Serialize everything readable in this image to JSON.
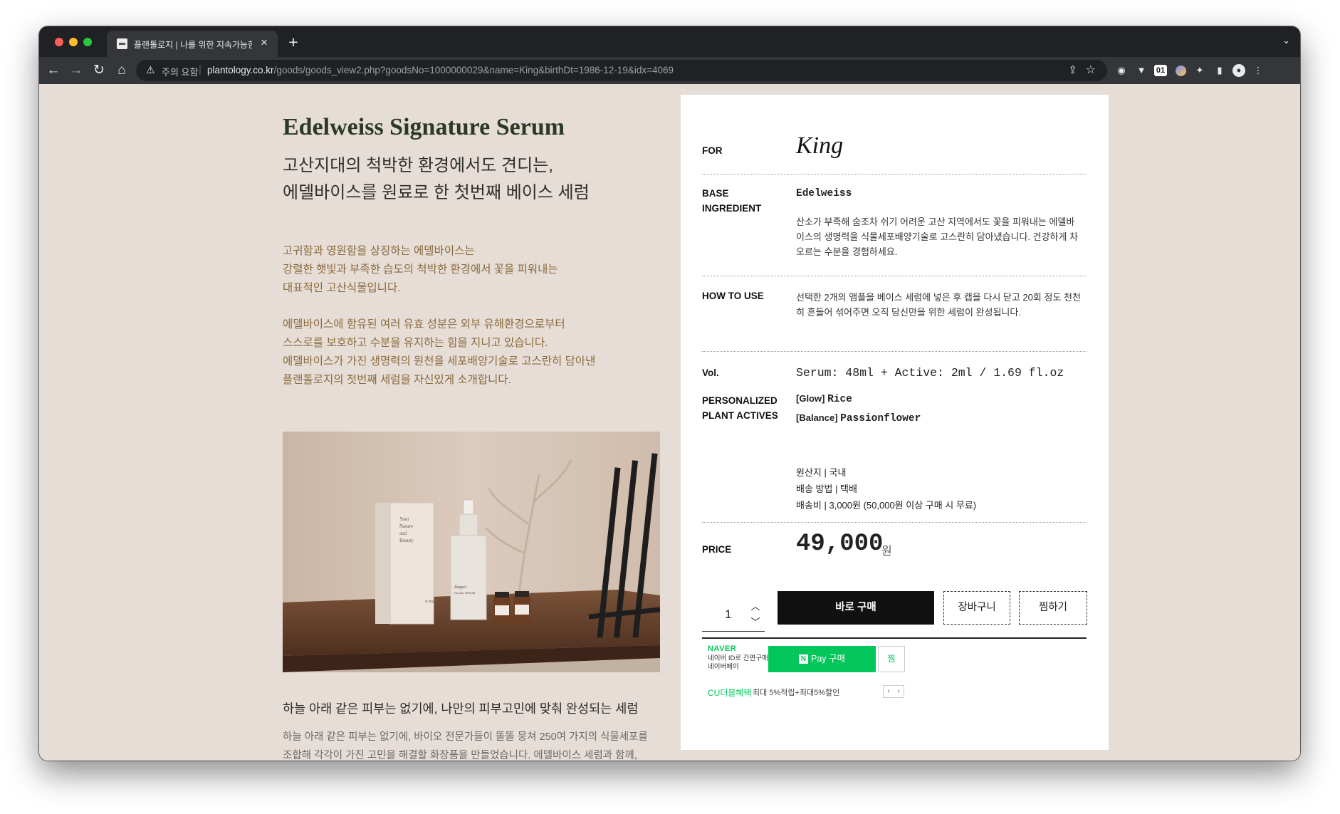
{
  "browser": {
    "tab_title": "플랜톨로지 | 나를 위한 지속가능한 화장품",
    "new_tab": "+",
    "tab_menu": "⌄",
    "security_warning": "주의 요함",
    "url_domain": "plantology.co.kr",
    "url_path": "/goods/goods_view2.php?goodsNo=1000000029&name=King&birthDt=1986-12-19&idx=4069",
    "extension_01": "01"
  },
  "product": {
    "title": "Edelweiss Signature Serum",
    "subtitle_line1": "고산지대의 척박한 환경에서도 견디는,",
    "subtitle_line2": "에델바이스를 원료로 한 첫번째 베이스 세럼",
    "paragraph1": [
      "고귀함과 영원함을 상징하는 에델바이스는",
      "강렬한 햇빛과 부족한 습도의 척박한 환경에서 꽃을 피워내는",
      "대표적인 고산식물입니다."
    ],
    "paragraph2": [
      "에델바이스에 함유된 여러 유효 성분은 외부 유해환경으로부터",
      "스스로를 보호하고 수분을 유지하는 힘을 지니고 있습니다.",
      "에델바이스가 가진 생명력의 원천을 세포배양기술로 고스란히 담아낸",
      "플랜톨로지의 첫번째 세럼을 자신있게 소개합니다."
    ],
    "image_box_text": [
      "Your",
      "Nature",
      "and",
      "Beauty"
    ],
    "image_box_brand": "It matters",
    "image_bottle_brand": "Raquel",
    "image_bottle_type": "FACIAL SERUM",
    "section_heading": "하늘 아래 같은 피부는 없기에, 나만의 피부고민에 맞춰 완성되는 세럼",
    "section_body": [
      "하늘 아래 같은 피부는 없기에, 바이오 전문가들이 똘똘 뭉쳐 250여 가지의 식물세포를",
      "조합해 각각이 가진 고민을 해결할 화장품을 만들었습니다. 에델바이스 세럼과 함께,"
    ]
  },
  "details": {
    "for_label": "FOR",
    "for_value": "King",
    "base_label_1": "BASE",
    "base_label_2": "INGREDIENT",
    "base_name": "Edelweiss",
    "base_desc": "산소가 부족해 숨조차 쉬기 어려운 고산 지역에서도 꽃을 피워내는 에델바이스의 생명력을 식물세포배양기술로 고스란히 담아냈습니다. 건강하게 차오르는 수분을 경험하세요.",
    "howto_label": "HOW TO USE",
    "howto_desc": "선택한 2개의 앰플을 베이스 세럼에 넣은 후 캡을 다시 닫고 20회 정도 천천히 흔들어 섞어주면 오직 당신만을 위한 세럼이 완성됩니다.",
    "vol_label": "Vol.",
    "vol_value": "Serum: 48ml + Active: 2ml / 1.69 fl.oz",
    "actives_label_1": "PERSONALIZED",
    "actives_label_2": "PLANT ACTIVES",
    "actives": [
      {
        "tag": "[Glow]",
        "name": "Rice"
      },
      {
        "tag": "[Balance]",
        "name": "Passionflower"
      }
    ],
    "origin": "원산지 | 국내",
    "shipping_method": "배송 방법 | 택배",
    "shipping_fee": "배송비 | 3,000원  (50,000원 이상 구매 시 무료)",
    "price_label": "PRICE",
    "price_value": "49,000",
    "price_unit": "원",
    "quantity": "1",
    "buy_now": "바로 구매",
    "cart": "장바구니",
    "wishlist": "찜하기",
    "naver_brand": "NAVER",
    "naver_note": "네이버 ID로 간편구매 네이버페이",
    "npay_badge": "N",
    "npay_label": "Pay 구매",
    "npay_zzim": "찜",
    "cu_label": "CU더블혜택",
    "cu_text": "최대 5%적립+최대5%할인"
  }
}
